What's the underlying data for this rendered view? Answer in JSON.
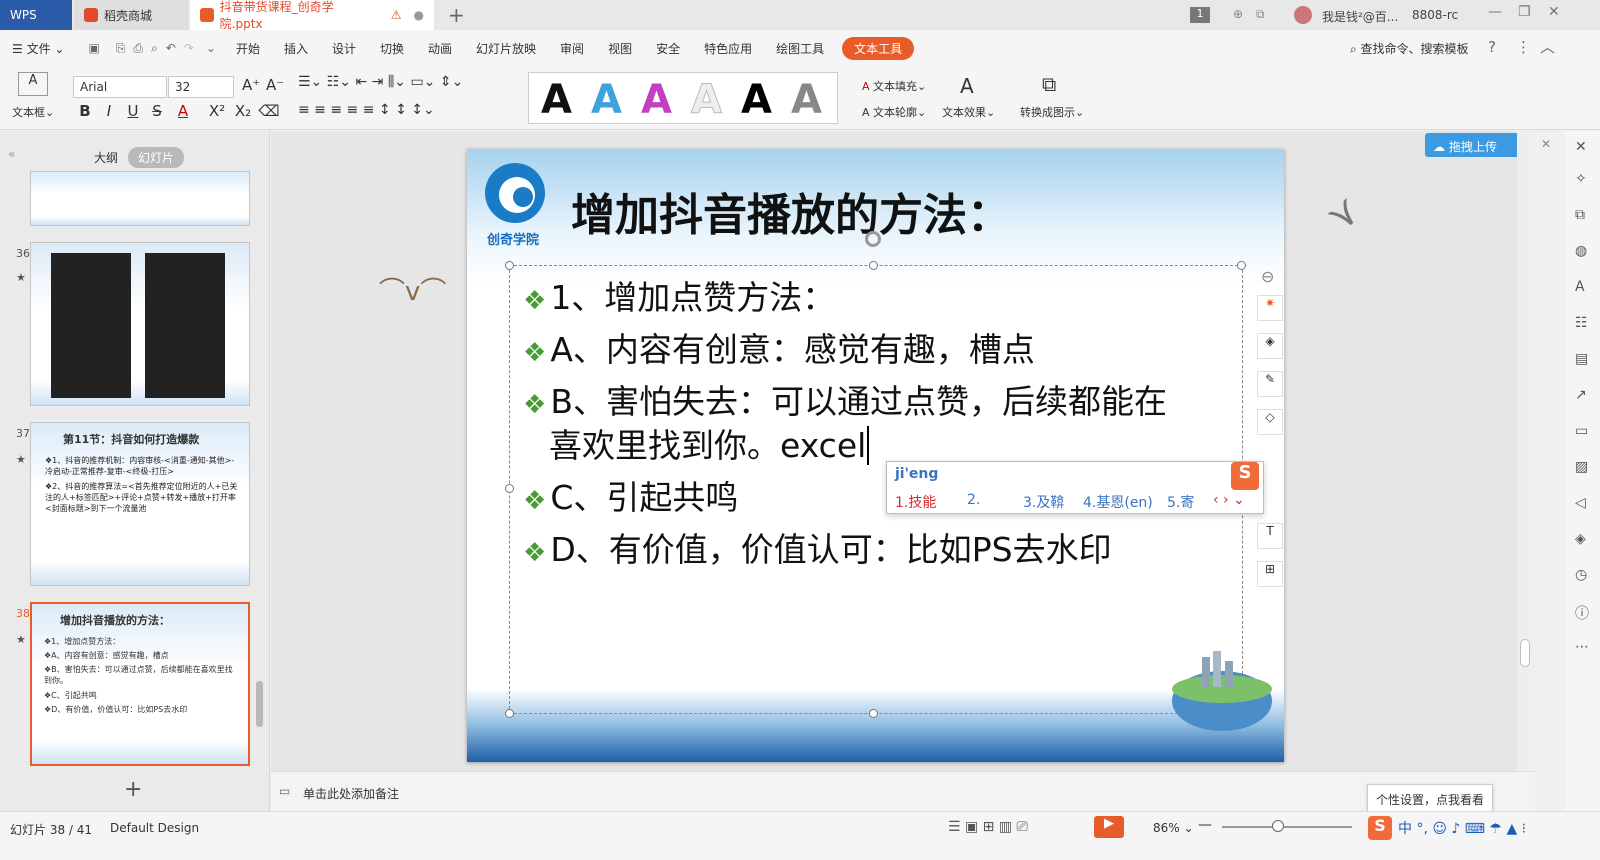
{
  "tabs": {
    "wps": "WPS",
    "store": "稻壳商城",
    "doc": "抖音带货课程_创奇学院.pptx"
  },
  "titlebar": {
    "page_count_badge": "1",
    "user": "我是钱²@百...",
    "user_id": "8808-rc"
  },
  "menu": {
    "file": "文件",
    "items": [
      "开始",
      "插入",
      "设计",
      "切换",
      "动画",
      "幻灯片放映",
      "审阅",
      "视图",
      "安全",
      "特色应用",
      "绘图工具"
    ],
    "active": "文本工具",
    "search": "查找命令、搜索模板"
  },
  "ribbon": {
    "textbox": "文本框",
    "font": "Arial",
    "size": "32",
    "text_fill": "文本填充",
    "text_outline": "文本轮廓",
    "text_effect": "文本效果",
    "convert": "转换成图示"
  },
  "panel": {
    "outline_tab": "大纲",
    "slides_tab": "幻灯片"
  },
  "thumbs": [
    {
      "num": "36",
      "title": ""
    },
    {
      "num": "37",
      "title": "第11节：抖音如何打造爆款",
      "lines": [
        "❖1、抖音的推荐机制：内容审核-<消重-通知-其他>-冷启动-正常推荐-复审-<终极-打压>",
        "❖2、抖音的推荐算法=<首先推荐定位附近的人+已关注的人+标签匹配>+评论+点赞+转发+播放+打开率<封面标题>到下一个流量池"
      ]
    },
    {
      "num": "38",
      "title": "增加抖音播放的方法：",
      "lines": [
        "❖1、增加点赞方法：",
        "❖A、内容有创意：感觉有趣，槽点",
        "❖B、害怕失去：可以通过点赞，后续都能在喜欢里找到你。",
        "❖C、引起共鸣",
        "❖D、有价值，价值认可：比如PS去水印"
      ]
    }
  ],
  "slide": {
    "logo_text": "创奇学院",
    "title": "增加抖音播放的方法：",
    "bullets": [
      "1、增加点赞方法：",
      "A、内容有创意：感觉有趣，槽点",
      "B、害怕失去：可以通过点赞，后续都能在",
      "C、引起共鸣",
      "D、有价值，价值认可：比如PS去水印"
    ],
    "bullet_b_line2": "喜欢里找到你。excel"
  },
  "ime": {
    "input": "ji'eng",
    "c1": "1.技能",
    "c2": "2.",
    "c3": "3.及鞥",
    "c4": "4.基恩(en)",
    "c5": "5.寄"
  },
  "upload": "拖拽上传",
  "notes": "单击此处添加备注",
  "tooltip": "个性设置，点我看看",
  "status": {
    "slide_no": "幻灯片 38 / 41",
    "design": "Default Design",
    "zoom": "86%"
  },
  "colors": {
    "accent": "#e85c2a",
    "wps_blue": "#2b5caa",
    "bullet_green": "#4a9a3a",
    "ime_red": "#d52b2b",
    "ime_blue": "#3b73c3"
  }
}
